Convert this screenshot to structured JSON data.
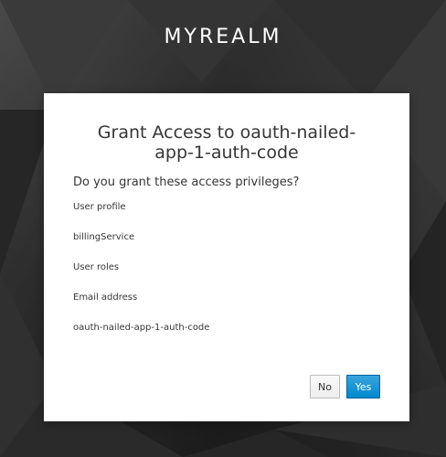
{
  "realm": {
    "name": "MYREALM"
  },
  "consent": {
    "title": "Grant Access to oauth-nailed-app-1-auth-code",
    "question": "Do you grant these access privileges?",
    "privileges": [
      "User profile",
      "billingService",
      "User roles",
      "Email address",
      "oauth-nailed-app-1-auth-code"
    ],
    "buttons": {
      "no_label": "No",
      "yes_label": "Yes"
    }
  },
  "colors": {
    "background": "#2b2b2b",
    "card": "#ffffff",
    "primary_button": "#0088ce",
    "text": "#363636"
  }
}
